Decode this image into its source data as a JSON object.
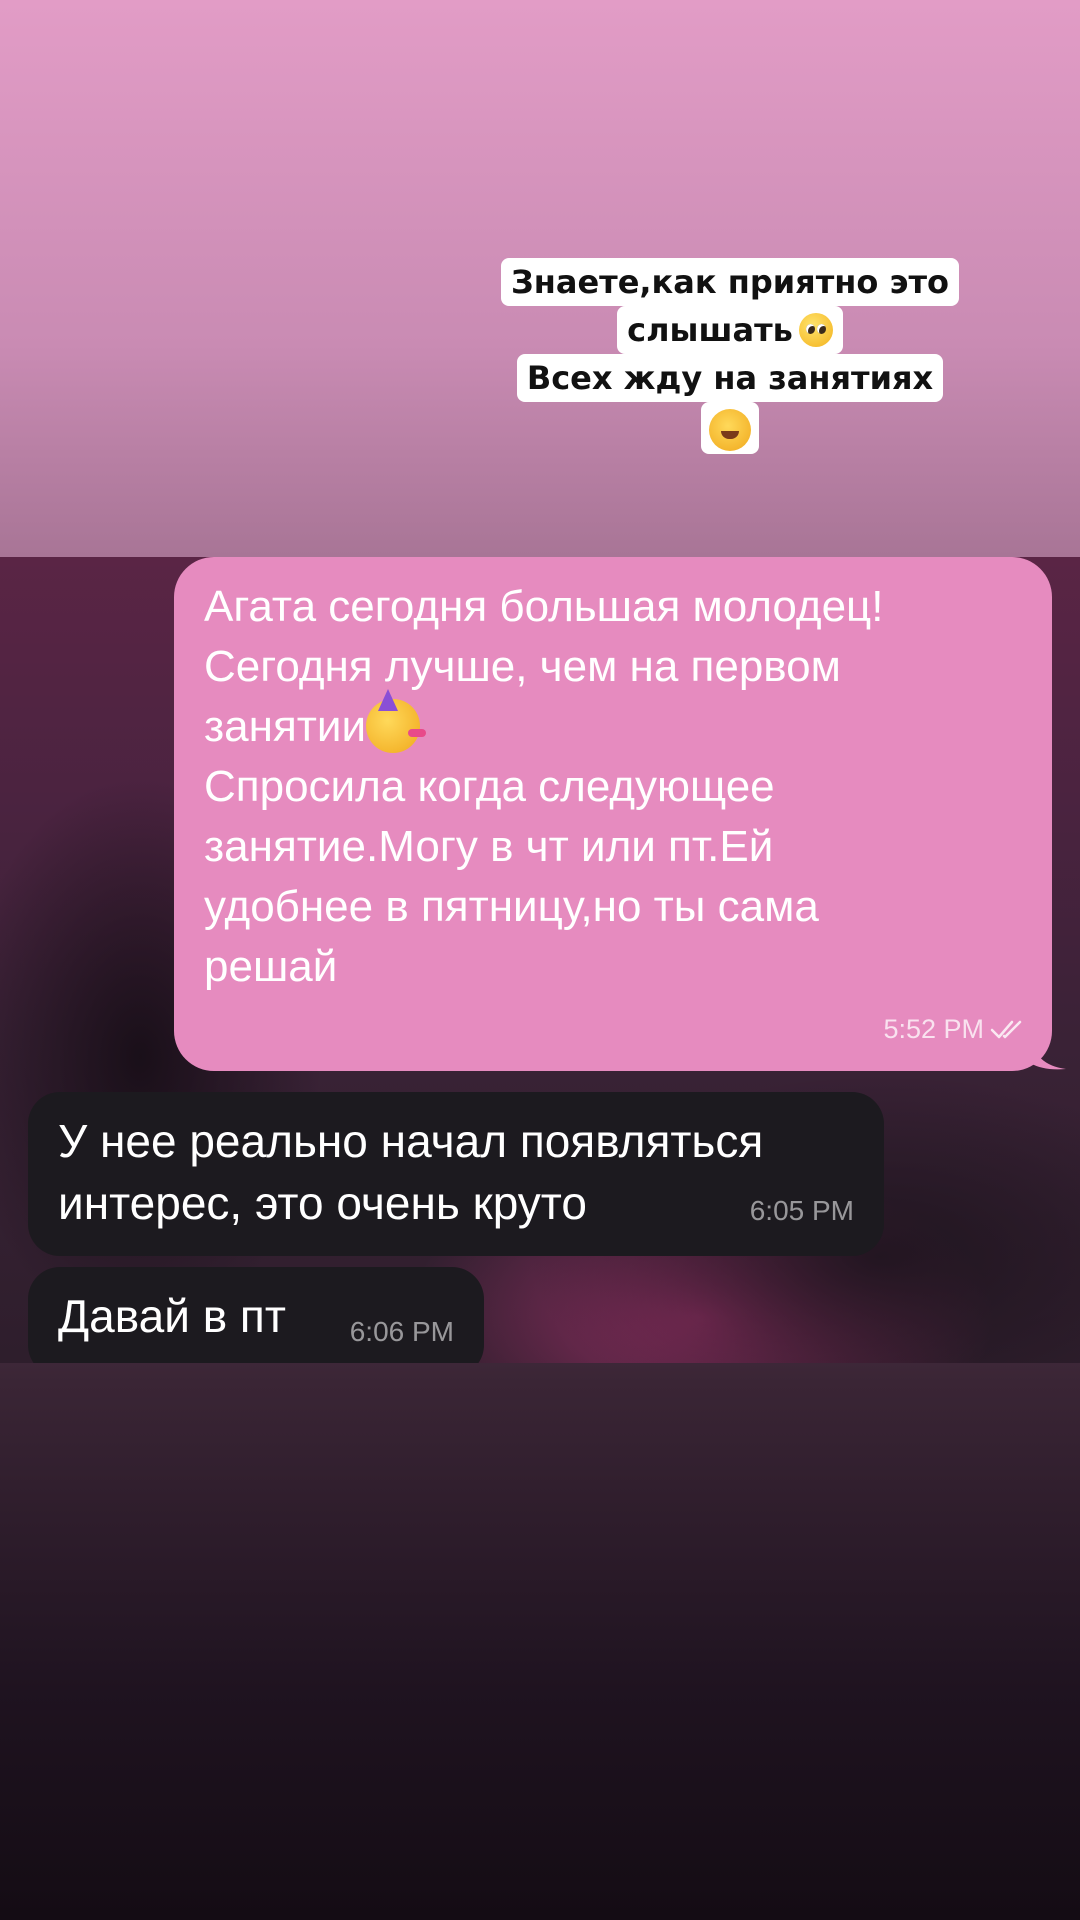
{
  "caption": {
    "line1": "Знаете,как приятно это",
    "line2": "слышать",
    "line2_emoji": "pleading-face-emoji",
    "line3": "Всех жду на занятиях",
    "line4_emoji": "hugging-face-emoji"
  },
  "chat": {
    "outgoing": {
      "text": "Агата сегодня большая молодец!\nСегодня лучше, чем на первом\nзанятии",
      "emoji": "partying-face-emoji",
      "text_after": "\nСпросила когда следующее\nзанятие.Могу в чт или пт.Ей\nудобнее в пятницу,но ты сама\nрешай",
      "time": "5:52 PM",
      "status_icon": "double-check-icon"
    },
    "incoming": [
      {
        "text": "У нее реально начал появляться\nинтерес, это очень круто",
        "time": "6:05 PM"
      },
      {
        "text": "Давай в пт",
        "time": "6:06 PM"
      }
    ]
  },
  "colors": {
    "outgoing_bubble": "#e68bbf",
    "incoming_bubble": "#1c1a1f",
    "background_top": "#e29cc6",
    "background_bottom": "#140c14"
  }
}
